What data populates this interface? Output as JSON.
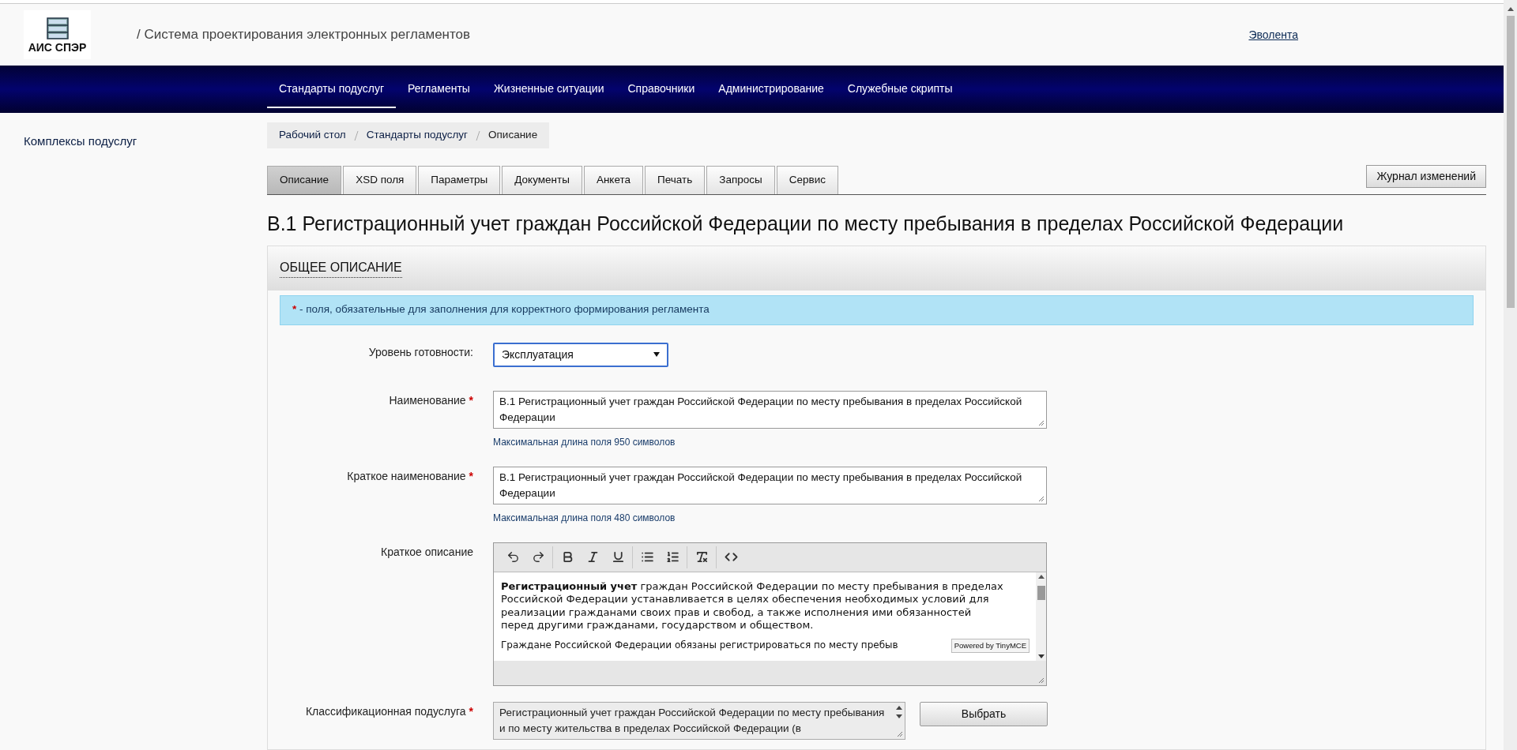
{
  "header": {
    "logo_text": "АИС СПЭР",
    "title": "/ Система проектирования электронных регламентов",
    "user_link": "Эволента"
  },
  "nav": [
    {
      "label": "Стандарты подуслуг",
      "selected": true
    },
    {
      "label": "Регламенты",
      "selected": false
    },
    {
      "label": "Жизненные ситуации",
      "selected": false
    },
    {
      "label": "Справочники",
      "selected": false
    },
    {
      "label": "Администрирование",
      "selected": false
    },
    {
      "label": "Служебные скрипты",
      "selected": false
    }
  ],
  "sidebar": {
    "items": [
      "Комплексы подуслуг"
    ]
  },
  "breadcrumbs": [
    "Рабочий стол",
    "Стандарты подуслуг",
    "Описание"
  ],
  "tabs": [
    {
      "label": "Описание",
      "selected": true
    },
    {
      "label": "XSD поля",
      "selected": false
    },
    {
      "label": "Параметры",
      "selected": false
    },
    {
      "label": "Документы",
      "selected": false
    },
    {
      "label": "Анкета",
      "selected": false
    },
    {
      "label": "Печать",
      "selected": false
    },
    {
      "label": "Запросы",
      "selected": false
    },
    {
      "label": "Сервис",
      "selected": false
    }
  ],
  "changelog_button": "Журнал изменений",
  "heading": "В.1 Регистрационный учет граждан Российской Федерации по месту пребывания в пределах Российской Федерации",
  "panel": {
    "title": "ОБЩЕЕ ОПИСАНИЕ",
    "notice": {
      "mark": "*",
      "text": "- поля, обязательные для заполнения для корректного формирования регламента"
    },
    "fields": [
      {
        "kind": "select",
        "label": "Уровень готовности:",
        "required": false,
        "value": "Эксплуатация"
      },
      {
        "kind": "textarea",
        "label": "Наименование",
        "required": true,
        "value": "В.1 Регистрационный учет граждан Российской Федерации по месту пребывания в пределах Российской Федерации",
        "hint": "Максимальная длина поля 950 символов"
      },
      {
        "kind": "textarea",
        "label": "Краткое наименование",
        "required": true,
        "value": "В.1 Регистрационный учет граждан Российской Федерации по месту пребывания в пределах Российской Федерации",
        "hint": "Максимальная длина поля 480 символов"
      },
      {
        "kind": "editor",
        "label": "Краткое описание",
        "required": false,
        "paragraphs": [
          "**Регистрационный учет** граждан Российской Федерации по месту пребывания в пределах Российской Федерации устанавливается в целях обеспечения необходимых условий для реализации гражданами своих прав и свобод, а также исполнения ими обязанностей перед другими гражданами, государством и обществом.",
          "Граждане Российской Федерации обязаны регистрироваться по месту пребыв"
        ],
        "badge": "Powered by TinyMCE"
      },
      {
        "kind": "picker",
        "label": "Классификационная подуслуга",
        "required": true,
        "value": "Регистрационный учет граждан Российской Федерации по месту пребывания и по месту  жительства в пределах Российской Федерации (в",
        "button": "Выбрать"
      }
    ]
  }
}
